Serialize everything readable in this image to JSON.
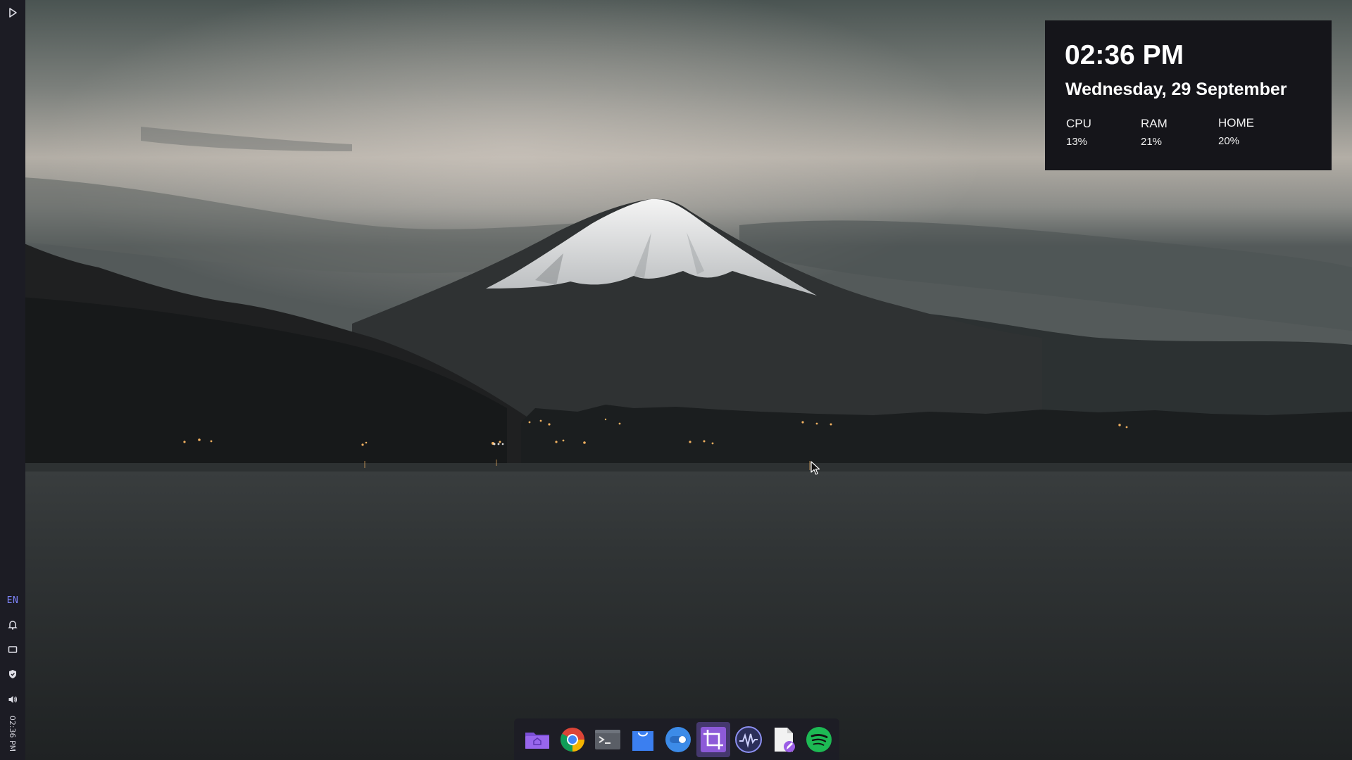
{
  "side_panel": {
    "language": "EN",
    "clock": "02:36 PM",
    "icons": [
      "play-icon",
      "bell-icon",
      "screen-icon",
      "shield-icon",
      "volume-icon"
    ]
  },
  "widget": {
    "time": "02:36 PM",
    "date": "Wednesday, 29 September",
    "stats": {
      "cpu_label": "CPU",
      "cpu_value": "13%",
      "ram_label": "RAM",
      "ram_value": "21%",
      "home_label": "HOME",
      "home_value": "20%"
    }
  },
  "dock": {
    "items": [
      {
        "name": "file-manager",
        "icon": "folder-home-icon"
      },
      {
        "name": "chrome",
        "icon": "chrome-icon"
      },
      {
        "name": "terminal",
        "icon": "terminal-icon"
      },
      {
        "name": "store",
        "icon": "shopping-bag-icon"
      },
      {
        "name": "settings-toggle",
        "icon": "toggle-icon"
      },
      {
        "name": "screenshot",
        "icon": "crop-icon",
        "active": true
      },
      {
        "name": "system-monitor",
        "icon": "waveform-icon"
      },
      {
        "name": "text-editor",
        "icon": "document-edit-icon"
      },
      {
        "name": "spotify",
        "icon": "spotify-icon"
      }
    ]
  },
  "colors": {
    "panel_bg": "#1c1c24",
    "widget_bg": "#15151a",
    "lang_accent": "#7f86ff",
    "dock_active": "#7a5ac8"
  }
}
